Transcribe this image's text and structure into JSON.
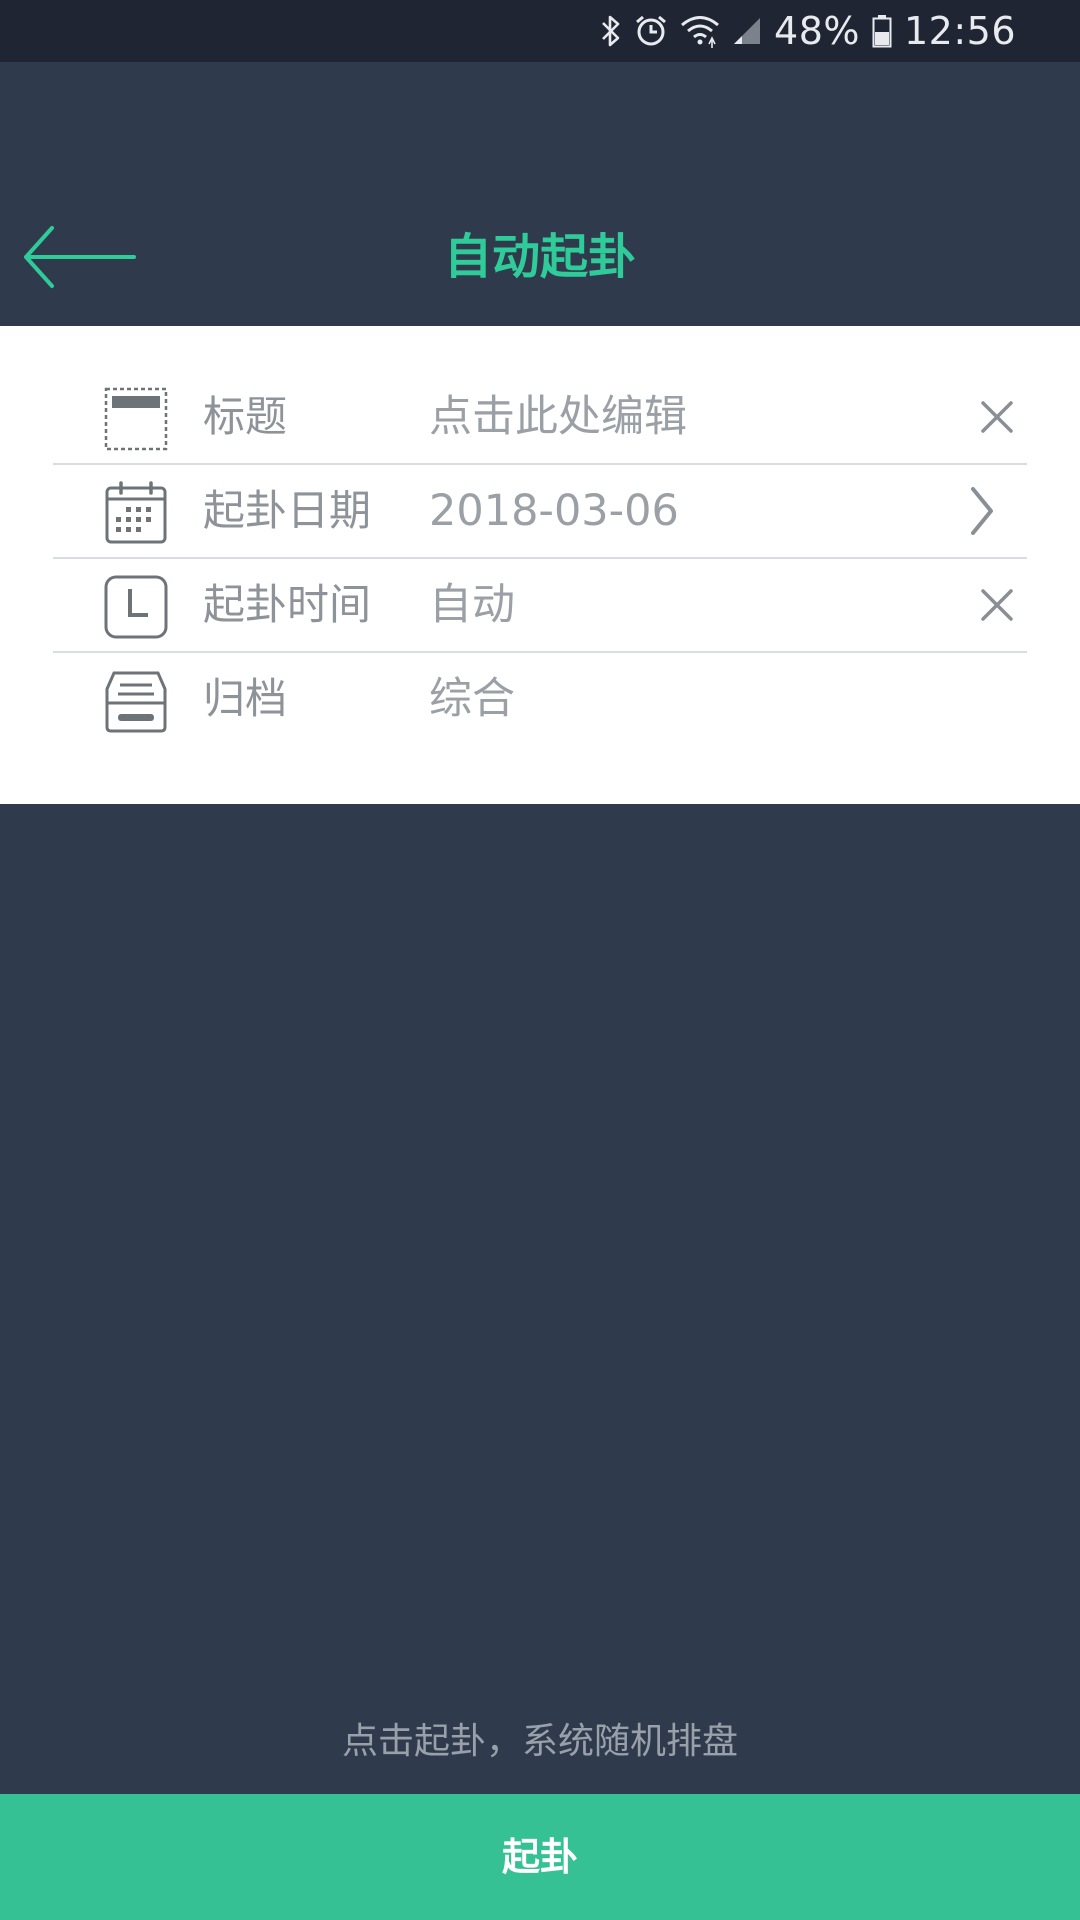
{
  "status_bar": {
    "battery": "48%",
    "time": "12:56",
    "icons": [
      "bluetooth-icon",
      "alarm-icon",
      "wifi-icon",
      "signal-icon",
      "battery-icon"
    ]
  },
  "header": {
    "title": "自动起卦",
    "back_icon": "arrow-left-icon"
  },
  "form": {
    "rows": [
      {
        "icon": "title-box-icon",
        "label": "标题",
        "value": "点击此处编辑",
        "action_icon": "close-icon"
      },
      {
        "icon": "calendar-icon",
        "label": "起卦日期",
        "value": "2018-03-06",
        "action_icon": "chevron-right-icon"
      },
      {
        "icon": "clock-icon",
        "label": "起卦时间",
        "value": "自动",
        "action_icon": "close-icon"
      },
      {
        "icon": "archive-icon",
        "label": "归档",
        "value": "综合"
      }
    ]
  },
  "hint": "点击起卦，系统随机排盘",
  "submit_label": "起卦",
  "colors": {
    "accent": "#2fcc9a",
    "button": "#36c195",
    "background": "#2f3b4c",
    "status_bar": "#1f2532"
  }
}
